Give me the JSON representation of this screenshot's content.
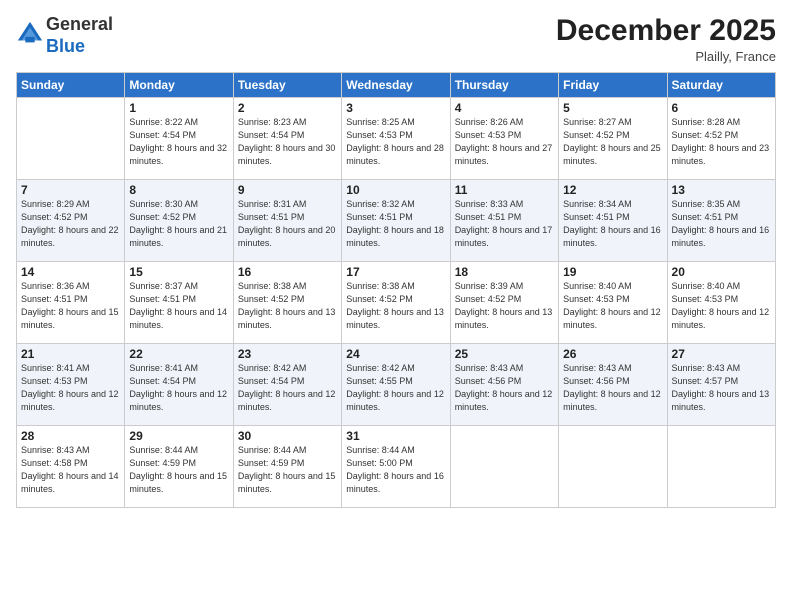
{
  "logo": {
    "general": "General",
    "blue": "Blue"
  },
  "header": {
    "month": "December 2025",
    "location": "Plailly, France"
  },
  "weekdays": [
    "Sunday",
    "Monday",
    "Tuesday",
    "Wednesday",
    "Thursday",
    "Friday",
    "Saturday"
  ],
  "weeks": [
    [
      {
        "day": "",
        "sunrise": "",
        "sunset": "",
        "daylight": ""
      },
      {
        "day": "1",
        "sunrise": "Sunrise: 8:22 AM",
        "sunset": "Sunset: 4:54 PM",
        "daylight": "Daylight: 8 hours and 32 minutes."
      },
      {
        "day": "2",
        "sunrise": "Sunrise: 8:23 AM",
        "sunset": "Sunset: 4:54 PM",
        "daylight": "Daylight: 8 hours and 30 minutes."
      },
      {
        "day": "3",
        "sunrise": "Sunrise: 8:25 AM",
        "sunset": "Sunset: 4:53 PM",
        "daylight": "Daylight: 8 hours and 28 minutes."
      },
      {
        "day": "4",
        "sunrise": "Sunrise: 8:26 AM",
        "sunset": "Sunset: 4:53 PM",
        "daylight": "Daylight: 8 hours and 27 minutes."
      },
      {
        "day": "5",
        "sunrise": "Sunrise: 8:27 AM",
        "sunset": "Sunset: 4:52 PM",
        "daylight": "Daylight: 8 hours and 25 minutes."
      },
      {
        "day": "6",
        "sunrise": "Sunrise: 8:28 AM",
        "sunset": "Sunset: 4:52 PM",
        "daylight": "Daylight: 8 hours and 23 minutes."
      }
    ],
    [
      {
        "day": "7",
        "sunrise": "Sunrise: 8:29 AM",
        "sunset": "Sunset: 4:52 PM",
        "daylight": "Daylight: 8 hours and 22 minutes."
      },
      {
        "day": "8",
        "sunrise": "Sunrise: 8:30 AM",
        "sunset": "Sunset: 4:52 PM",
        "daylight": "Daylight: 8 hours and 21 minutes."
      },
      {
        "day": "9",
        "sunrise": "Sunrise: 8:31 AM",
        "sunset": "Sunset: 4:51 PM",
        "daylight": "Daylight: 8 hours and 20 minutes."
      },
      {
        "day": "10",
        "sunrise": "Sunrise: 8:32 AM",
        "sunset": "Sunset: 4:51 PM",
        "daylight": "Daylight: 8 hours and 18 minutes."
      },
      {
        "day": "11",
        "sunrise": "Sunrise: 8:33 AM",
        "sunset": "Sunset: 4:51 PM",
        "daylight": "Daylight: 8 hours and 17 minutes."
      },
      {
        "day": "12",
        "sunrise": "Sunrise: 8:34 AM",
        "sunset": "Sunset: 4:51 PM",
        "daylight": "Daylight: 8 hours and 16 minutes."
      },
      {
        "day": "13",
        "sunrise": "Sunrise: 8:35 AM",
        "sunset": "Sunset: 4:51 PM",
        "daylight": "Daylight: 8 hours and 16 minutes."
      }
    ],
    [
      {
        "day": "14",
        "sunrise": "Sunrise: 8:36 AM",
        "sunset": "Sunset: 4:51 PM",
        "daylight": "Daylight: 8 hours and 15 minutes."
      },
      {
        "day": "15",
        "sunrise": "Sunrise: 8:37 AM",
        "sunset": "Sunset: 4:51 PM",
        "daylight": "Daylight: 8 hours and 14 minutes."
      },
      {
        "day": "16",
        "sunrise": "Sunrise: 8:38 AM",
        "sunset": "Sunset: 4:52 PM",
        "daylight": "Daylight: 8 hours and 13 minutes."
      },
      {
        "day": "17",
        "sunrise": "Sunrise: 8:38 AM",
        "sunset": "Sunset: 4:52 PM",
        "daylight": "Daylight: 8 hours and 13 minutes."
      },
      {
        "day": "18",
        "sunrise": "Sunrise: 8:39 AM",
        "sunset": "Sunset: 4:52 PM",
        "daylight": "Daylight: 8 hours and 13 minutes."
      },
      {
        "day": "19",
        "sunrise": "Sunrise: 8:40 AM",
        "sunset": "Sunset: 4:53 PM",
        "daylight": "Daylight: 8 hours and 12 minutes."
      },
      {
        "day": "20",
        "sunrise": "Sunrise: 8:40 AM",
        "sunset": "Sunset: 4:53 PM",
        "daylight": "Daylight: 8 hours and 12 minutes."
      }
    ],
    [
      {
        "day": "21",
        "sunrise": "Sunrise: 8:41 AM",
        "sunset": "Sunset: 4:53 PM",
        "daylight": "Daylight: 8 hours and 12 minutes."
      },
      {
        "day": "22",
        "sunrise": "Sunrise: 8:41 AM",
        "sunset": "Sunset: 4:54 PM",
        "daylight": "Daylight: 8 hours and 12 minutes."
      },
      {
        "day": "23",
        "sunrise": "Sunrise: 8:42 AM",
        "sunset": "Sunset: 4:54 PM",
        "daylight": "Daylight: 8 hours and 12 minutes."
      },
      {
        "day": "24",
        "sunrise": "Sunrise: 8:42 AM",
        "sunset": "Sunset: 4:55 PM",
        "daylight": "Daylight: 8 hours and 12 minutes."
      },
      {
        "day": "25",
        "sunrise": "Sunrise: 8:43 AM",
        "sunset": "Sunset: 4:56 PM",
        "daylight": "Daylight: 8 hours and 12 minutes."
      },
      {
        "day": "26",
        "sunrise": "Sunrise: 8:43 AM",
        "sunset": "Sunset: 4:56 PM",
        "daylight": "Daylight: 8 hours and 12 minutes."
      },
      {
        "day": "27",
        "sunrise": "Sunrise: 8:43 AM",
        "sunset": "Sunset: 4:57 PM",
        "daylight": "Daylight: 8 hours and 13 minutes."
      }
    ],
    [
      {
        "day": "28",
        "sunrise": "Sunrise: 8:43 AM",
        "sunset": "Sunset: 4:58 PM",
        "daylight": "Daylight: 8 hours and 14 minutes."
      },
      {
        "day": "29",
        "sunrise": "Sunrise: 8:44 AM",
        "sunset": "Sunset: 4:59 PM",
        "daylight": "Daylight: 8 hours and 15 minutes."
      },
      {
        "day": "30",
        "sunrise": "Sunrise: 8:44 AM",
        "sunset": "Sunset: 4:59 PM",
        "daylight": "Daylight: 8 hours and 15 minutes."
      },
      {
        "day": "31",
        "sunrise": "Sunrise: 8:44 AM",
        "sunset": "Sunset: 5:00 PM",
        "daylight": "Daylight: 8 hours and 16 minutes."
      },
      {
        "day": "",
        "sunrise": "",
        "sunset": "",
        "daylight": ""
      },
      {
        "day": "",
        "sunrise": "",
        "sunset": "",
        "daylight": ""
      },
      {
        "day": "",
        "sunrise": "",
        "sunset": "",
        "daylight": ""
      }
    ]
  ]
}
